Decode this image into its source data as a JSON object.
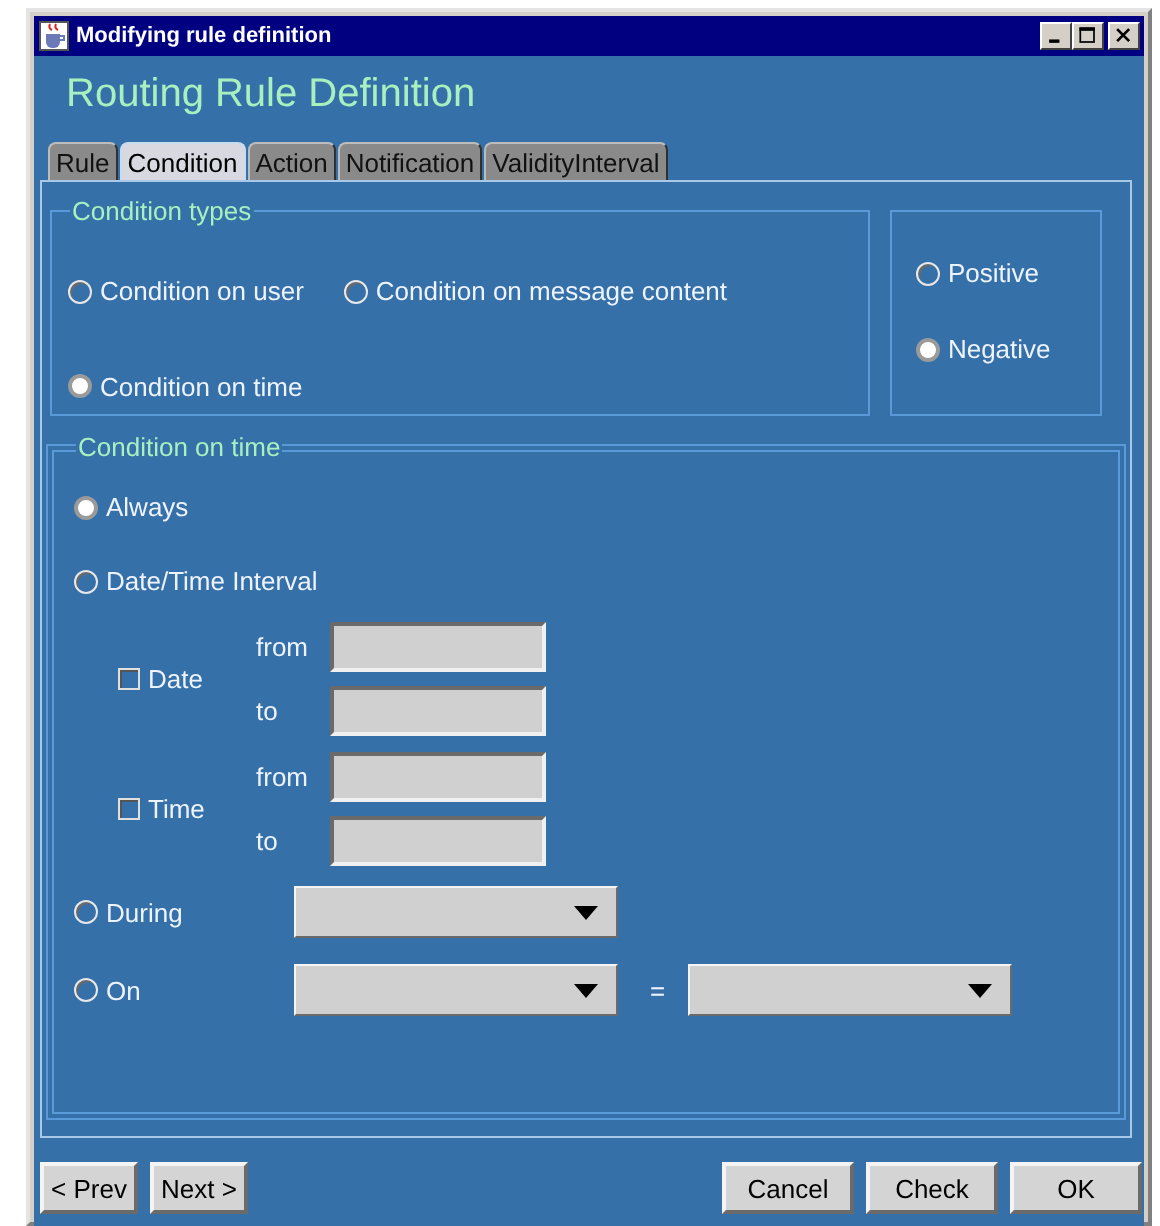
{
  "window": {
    "title": "Modifying rule definition"
  },
  "heading": "Routing Rule Definition",
  "tabs": [
    {
      "label": "Rule",
      "selected": false
    },
    {
      "label": "Condition",
      "selected": true
    },
    {
      "label": "Action",
      "selected": false
    },
    {
      "label": "Notification",
      "selected": false
    },
    {
      "label": "ValidityInterval",
      "selected": false
    }
  ],
  "condition_types": {
    "legend": "Condition types",
    "options": [
      {
        "label": "Condition on user",
        "selected": false
      },
      {
        "label": "Condition on message content",
        "selected": false
      },
      {
        "label": "Condition on time",
        "selected": true
      }
    ]
  },
  "polarity": [
    {
      "label": "Positive",
      "selected": false
    },
    {
      "label": "Negative",
      "selected": true
    }
  ],
  "condition_on_time": {
    "legend": "Condition on time",
    "always": {
      "label": "Always",
      "selected": true
    },
    "interval": {
      "label": "Date/Time Interval",
      "selected": false,
      "ranges": [
        {
          "label": "Date",
          "checked": false,
          "from_label": "from",
          "to_label": "to"
        },
        {
          "label": "Time",
          "checked": false,
          "from_label": "from",
          "to_label": "to"
        }
      ]
    },
    "during": {
      "label": "During",
      "selected": false
    },
    "on": {
      "label": "On",
      "selected": false,
      "separator": "="
    }
  },
  "nav_buttons": [
    "< Prev",
    "Next >"
  ],
  "action_buttons": [
    "Cancel",
    "Check",
    "OK"
  ]
}
